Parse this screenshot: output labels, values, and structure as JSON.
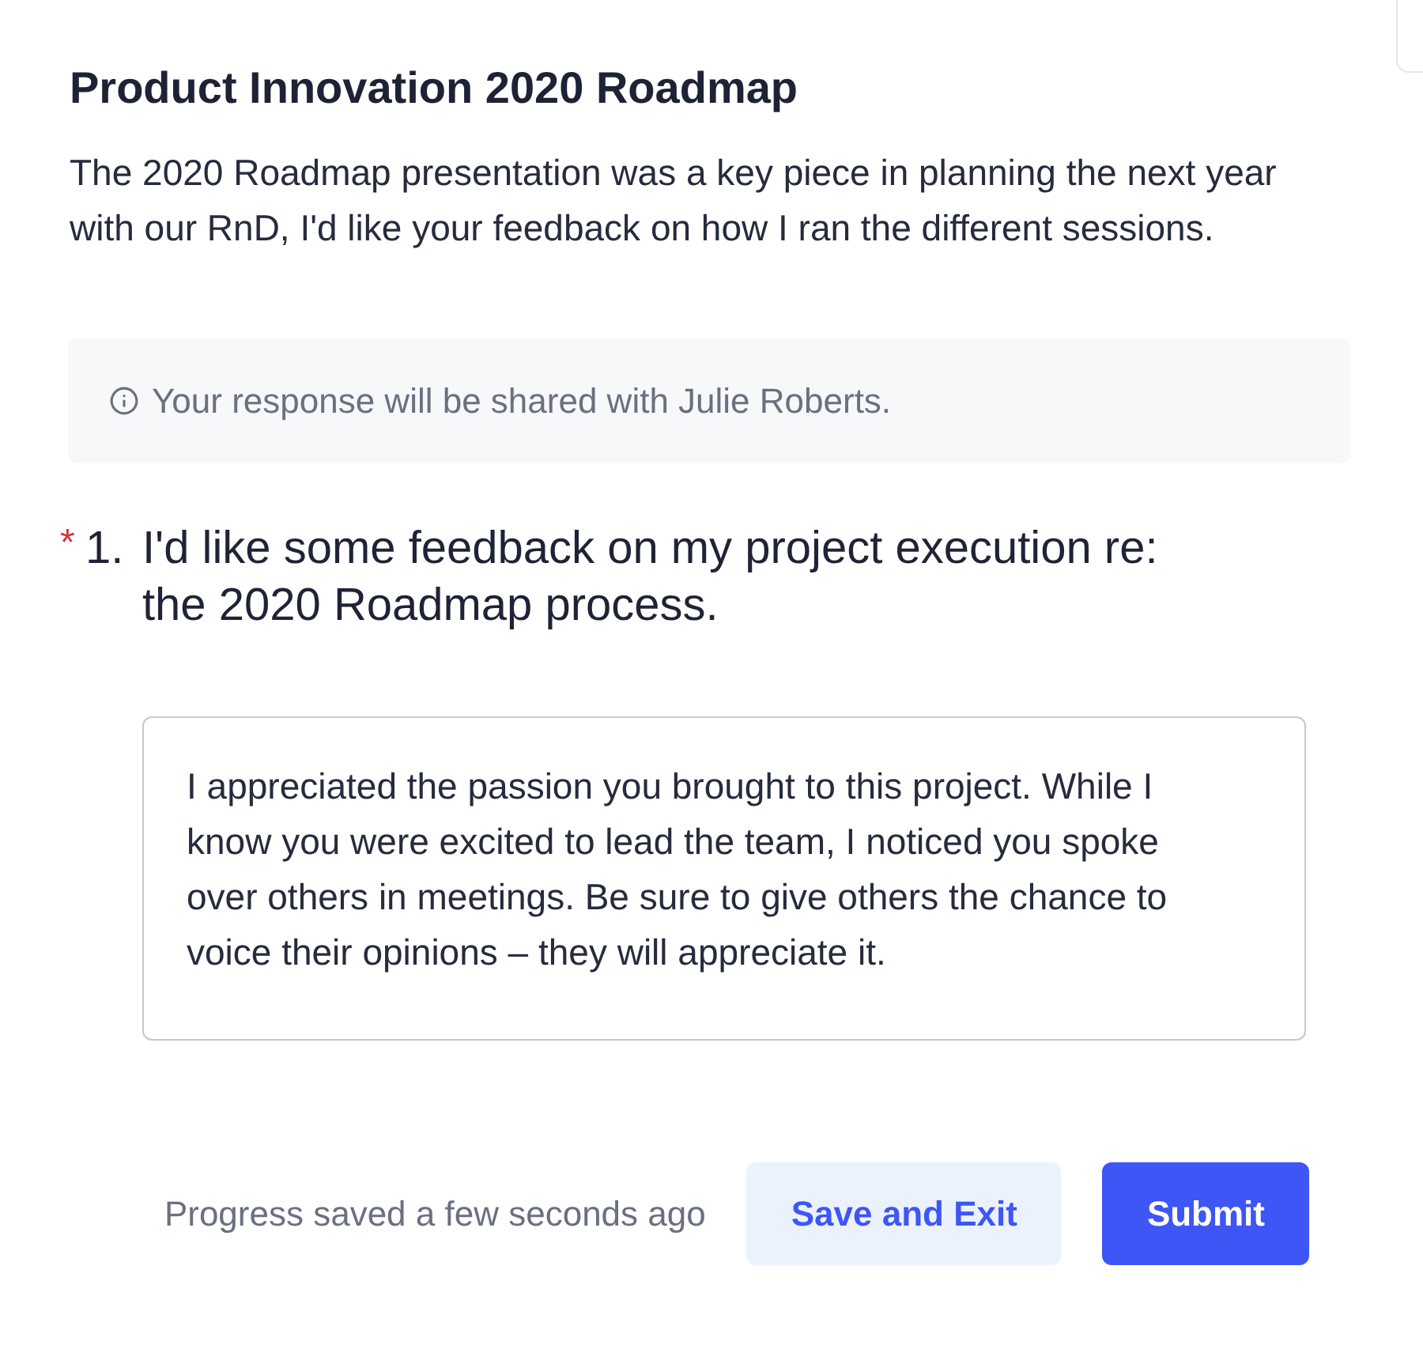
{
  "header": {
    "title": "Product Innovation 2020 Roadmap",
    "description": "The 2020 Roadmap presentation was a key piece in planning the next year with our RnD, I'd like your feedback on how I ran the different sessions."
  },
  "notice": {
    "text": "Your response will be shared with Julie Roberts."
  },
  "questions": [
    {
      "required_mark": "*",
      "number": "1.",
      "text": "I'd like some feedback on my project execution re: the 2020 Roadmap process.",
      "answer": "I appreciated the passion you brought to this project. While I know you were excited to lead the team, I noticed you spoke over others in meetings. Be sure to give others the chance to voice their opinions – they will appreciate it."
    }
  ],
  "footer": {
    "status": "Progress saved a few seconds ago",
    "buttons": [
      {
        "label": "Save and Exit",
        "kind": "secondary"
      },
      {
        "label": "Submit",
        "kind": "primary"
      }
    ]
  }
}
